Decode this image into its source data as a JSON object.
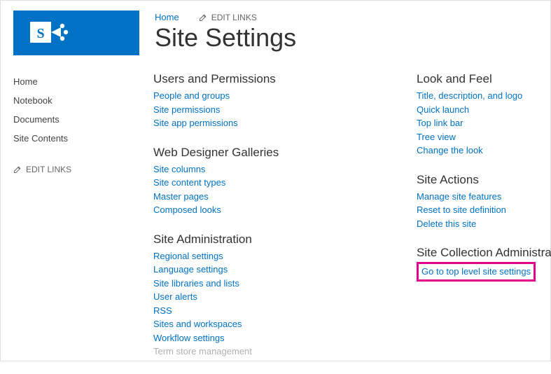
{
  "breadcrumb": {
    "home": "Home",
    "edit_links": "EDIT LINKS"
  },
  "page_title": "Site Settings",
  "sidebar": {
    "items": [
      "Home",
      "Notebook",
      "Documents",
      "Site Contents"
    ],
    "edit_links": "EDIT LINKS"
  },
  "columns": [
    [
      {
        "heading": "Users and Permissions",
        "links": [
          {
            "label": "People and groups"
          },
          {
            "label": "Site permissions"
          },
          {
            "label": "Site app permissions"
          }
        ]
      },
      {
        "heading": "Web Designer Galleries",
        "links": [
          {
            "label": "Site columns"
          },
          {
            "label": "Site content types"
          },
          {
            "label": "Master pages"
          },
          {
            "label": "Composed looks"
          }
        ]
      },
      {
        "heading": "Site Administration",
        "links": [
          {
            "label": "Regional settings"
          },
          {
            "label": "Language settings"
          },
          {
            "label": "Site libraries and lists"
          },
          {
            "label": "User alerts"
          },
          {
            "label": "RSS"
          },
          {
            "label": "Sites and workspaces"
          },
          {
            "label": "Workflow settings"
          },
          {
            "label": "Term store management",
            "disabled": true
          }
        ]
      }
    ],
    [
      {
        "heading": "Look and Feel",
        "links": [
          {
            "label": "Title, description, and logo"
          },
          {
            "label": "Quick launch"
          },
          {
            "label": "Top link bar"
          },
          {
            "label": "Tree view"
          },
          {
            "label": "Change the look"
          }
        ]
      },
      {
        "heading": "Site Actions",
        "links": [
          {
            "label": "Manage site features"
          },
          {
            "label": "Reset to site definition"
          },
          {
            "label": "Delete this site"
          }
        ]
      },
      {
        "heading": "Site Collection Administration",
        "links": [
          {
            "label": "Go to top level site settings",
            "highlight": true
          }
        ]
      }
    ]
  ]
}
